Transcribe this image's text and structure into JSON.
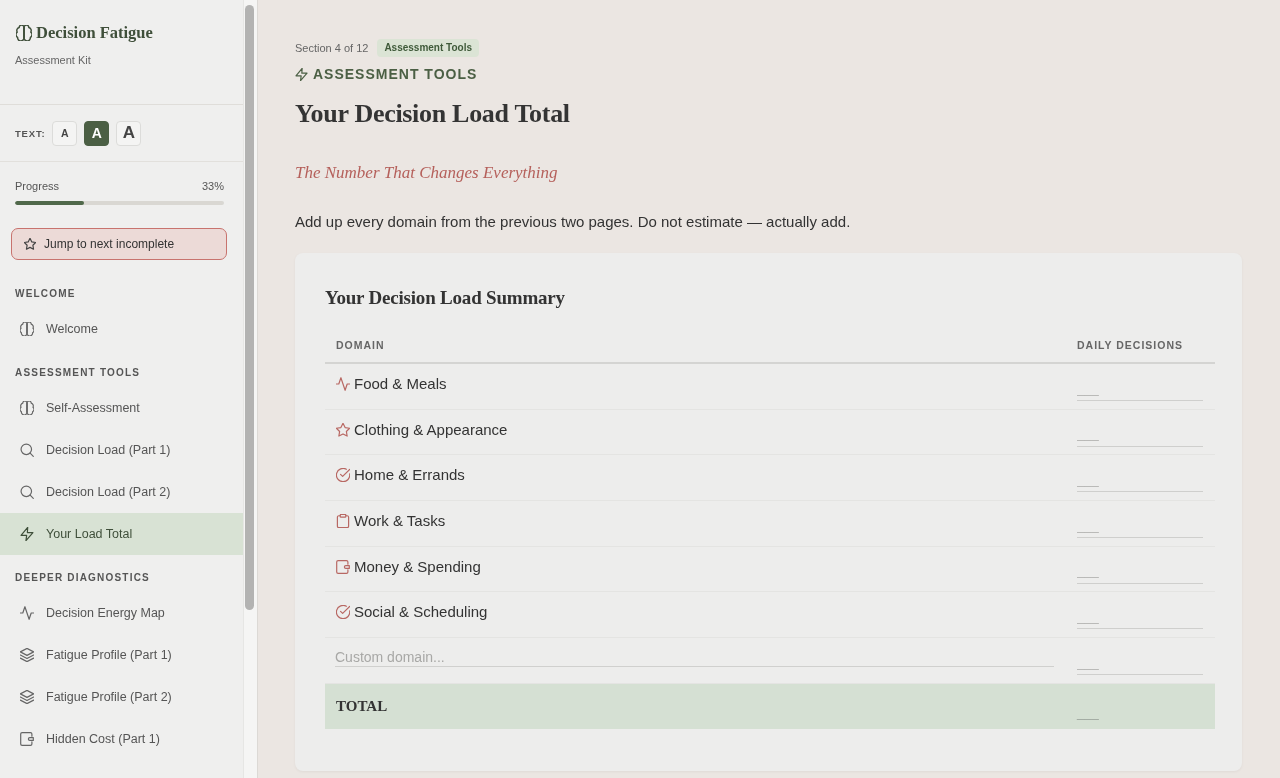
{
  "sidebar": {
    "brand": {
      "title": "Decision Fatigue",
      "subtitle": "Assessment Kit"
    },
    "text_size": {
      "label": "TEXT:",
      "options": [
        {
          "label": "A",
          "kind": "small",
          "selected": false
        },
        {
          "label": "A",
          "kind": "medium",
          "selected": true
        },
        {
          "label": "A",
          "kind": "large",
          "selected": false
        }
      ]
    },
    "progress": {
      "label": "Progress",
      "reading": "33%",
      "level": 0.33
    },
    "jump_button": {
      "label": "Jump to next incomplete"
    },
    "sections": [
      {
        "heading": "WELCOME",
        "items": [
          {
            "label": "Welcome",
            "kind": "brain",
            "selected": false
          }
        ]
      },
      {
        "heading": "ASSESSMENT TOOLS",
        "items": [
          {
            "label": "Self-Assessment",
            "kind": "brain",
            "selected": false
          },
          {
            "label": "Decision Load (Part 1)",
            "kind": "search",
            "selected": false
          },
          {
            "label": "Decision Load (Part 2)",
            "kind": "search",
            "selected": false
          },
          {
            "label": "Your Load Total",
            "kind": "lightning",
            "selected": true
          }
        ]
      },
      {
        "heading": "DEEPER DIAGNOSTICS",
        "items": [
          {
            "label": "Decision Energy Map",
            "kind": "pulse",
            "selected": false
          },
          {
            "label": "Fatigue Profile (Part 1)",
            "kind": "layers",
            "selected": false
          },
          {
            "label": "Fatigue Profile (Part 2)",
            "kind": "layers",
            "selected": false
          },
          {
            "label": "Hidden Cost (Part 1)",
            "kind": "wallet",
            "selected": false
          }
        ]
      }
    ]
  },
  "main": {
    "section_counter": "Section 4 of 12",
    "badge": "Assessment Tools",
    "eyebrow": "ASSESSMENT TOOLS",
    "title": "Your Decision Load Total",
    "subtitle": "The Number That Changes Everything",
    "intro": "Add up every domain from the previous two pages. Do not estimate — actually add.",
    "card": {
      "title": "Your Decision Load Summary",
      "table": {
        "columns": [
          "DOMAIN",
          "DAILY DECISIONS"
        ],
        "rows": [
          {
            "domain": "Food & Meals",
            "kind": "pulse",
            "placeholder": "___"
          },
          {
            "domain": "Clothing & Appearance",
            "kind": "star",
            "placeholder": "___"
          },
          {
            "domain": "Home & Errands",
            "kind": "check",
            "placeholder": "___"
          },
          {
            "domain": "Work & Tasks",
            "kind": "clipboard",
            "placeholder": "___"
          },
          {
            "domain": "Money & Spending",
            "kind": "wallet",
            "placeholder": "___"
          },
          {
            "domain": "Social & Scheduling",
            "kind": "check",
            "placeholder": "___"
          }
        ],
        "custom_row": {
          "placeholder": "Custom domain...",
          "count_placeholder": "___"
        },
        "total": {
          "label": "TOTAL",
          "value": "___"
        }
      }
    }
  }
}
